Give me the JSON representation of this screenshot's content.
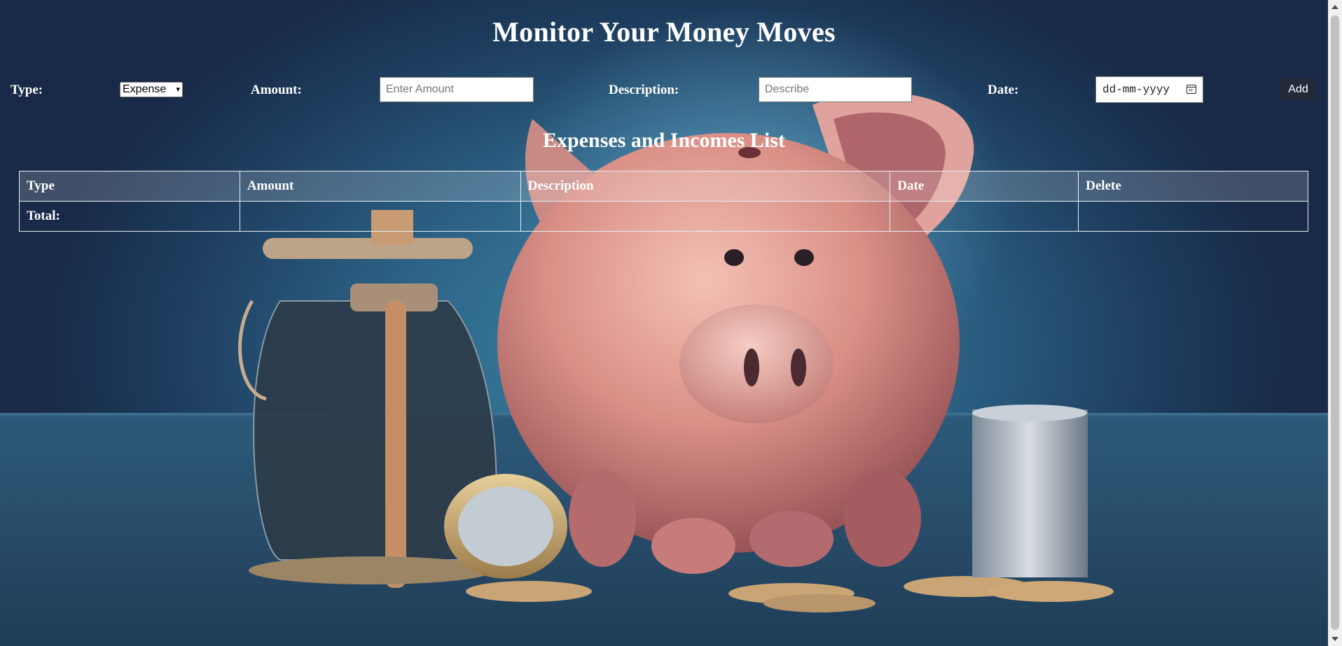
{
  "header": {
    "title": "Monitor Your Money Moves"
  },
  "form": {
    "type_label": "Type:",
    "type_selected": "Expense",
    "amount_label": "Amount:",
    "amount_placeholder": "Enter Amount",
    "description_label": "Description:",
    "description_placeholder": "Describe",
    "date_label": "Date:",
    "date_placeholder": "dd-mm-yyyy",
    "add_label": "Add"
  },
  "list": {
    "title": "Expenses and Incomes List",
    "columns": [
      "Type",
      "Amount",
      "Description",
      "Date",
      "Delete"
    ],
    "total_label": "Total:"
  },
  "icons": {
    "date_picker": "calendar-icon",
    "select_arrow": "chevron-down-icon"
  },
  "colors": {
    "add_button_bg": "#222a3a",
    "text": "#ffffff"
  }
}
